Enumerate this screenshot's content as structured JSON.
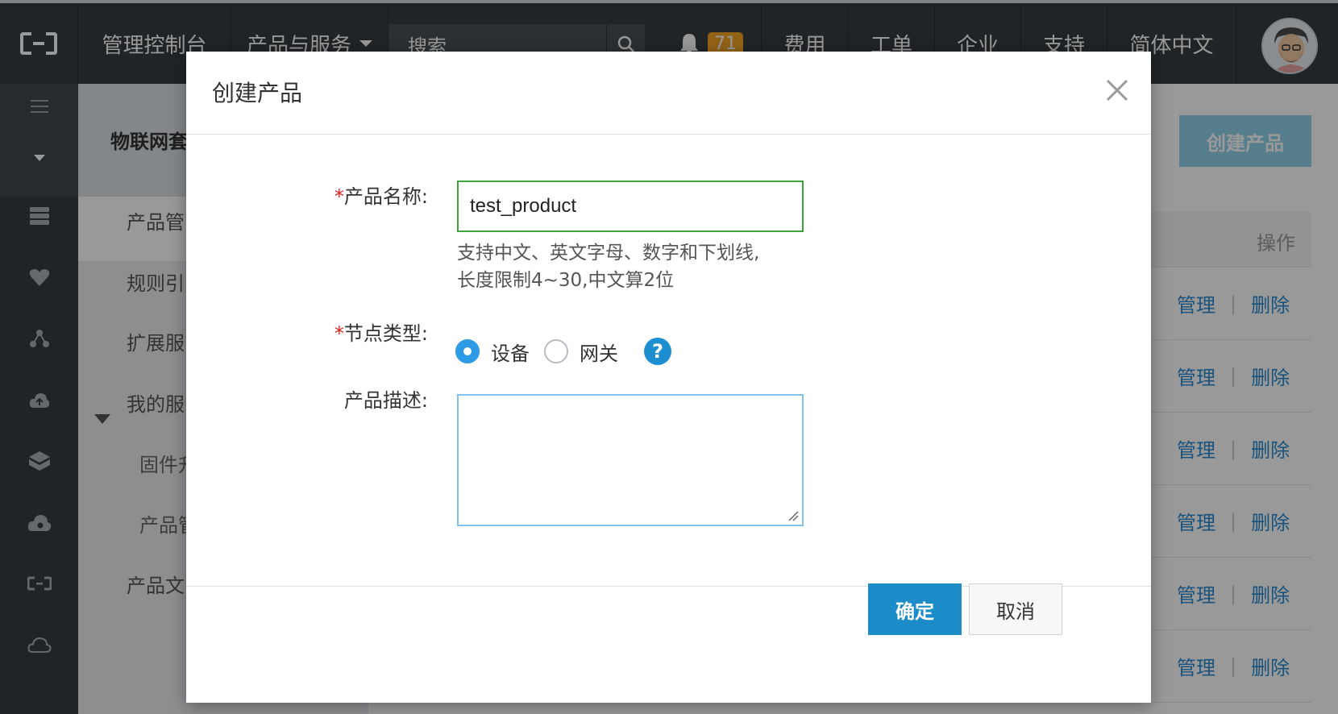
{
  "topbar": {
    "console": "管理控制台",
    "products": "产品与服务",
    "search_placeholder": "搜索",
    "notification_count": "71",
    "fee": "费用",
    "ticket": "工单",
    "enterprise": "企业",
    "support": "支持",
    "language": "简体中文"
  },
  "rail": {
    "icons": [
      "menu-icon",
      "collapse-caret-icon",
      "server-icon",
      "heart-icon",
      "network-icon",
      "cloud-upload-icon",
      "box-icon",
      "cloud-settings-icon",
      "logo-icon",
      "cloud-icon"
    ]
  },
  "subnav": {
    "title": "物联网套",
    "items": [
      "产品管",
      "规则引",
      "扩展服",
      "我的服",
      "产品文"
    ],
    "subitems": [
      "固件升",
      "产品管"
    ]
  },
  "main": {
    "create_button": "创建产品",
    "op_header": "操作",
    "row_actions": {
      "manage": "管理",
      "delete": "删除",
      "sep": "|"
    }
  },
  "modal": {
    "title": "创建产品",
    "fields": {
      "name": {
        "required_mark": "*",
        "label": "产品名称:",
        "value": "test_product",
        "hint_line1": "支持中文、英文字母、数字和下划线,",
        "hint_line2": "长度限制4~30,中文算2位"
      },
      "node_type": {
        "required_mark": "*",
        "label": "节点类型:",
        "options": [
          "设备",
          "网关"
        ],
        "selected": "设备"
      },
      "description": {
        "label": "产品描述:",
        "value": ""
      }
    },
    "confirm": "确定",
    "cancel": "取消"
  },
  "colors": {
    "topbar_bg": "#373d41",
    "accent": "#1b8cc7",
    "create_button_bg": "#8fd3ec",
    "link": "#2b8bd1",
    "badge": "#f5a623",
    "input_valid_border": "#3fa23a"
  }
}
